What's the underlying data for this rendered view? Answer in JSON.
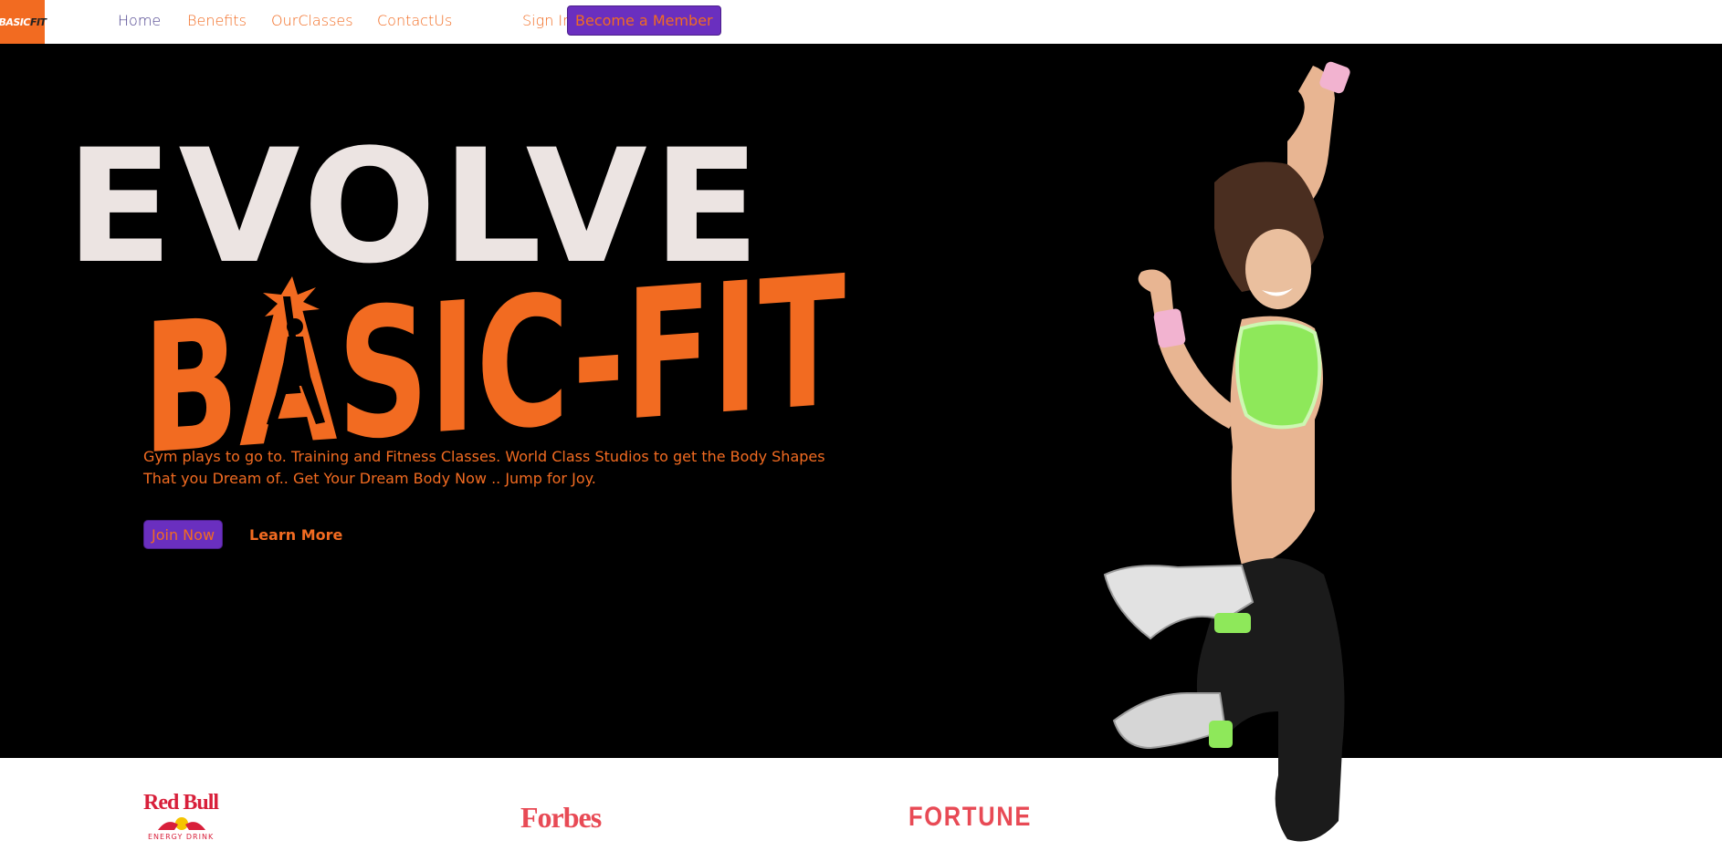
{
  "nav": {
    "logo_text_a": "BASIC",
    "logo_text_b": "FIT",
    "links": [
      "Home",
      "Benefits",
      "OurClasses",
      "ContactUs"
    ],
    "signin": "Sign In",
    "member_button": "Become a Member"
  },
  "hero": {
    "headline": "EVOLVE",
    "brand": "BASIC-FIT",
    "description": "Gym plays to go to. Training and Fitness Classes. World Class Studios to get the Body Shapes That you Dream of.. Get Your Dream Body Now .. Jump for Joy.",
    "join_button": "Join Now",
    "learn_more": "Learn More"
  },
  "sponsors": {
    "redbull_title": "Red Bull",
    "redbull_sub": "ENERGY DRINK",
    "forbes": "Forbes",
    "fortune": "FORTUNE"
  },
  "colors": {
    "accent": "#f26b21",
    "button": "#6a2fbf",
    "nav_active": "#4a3f8c",
    "sponsor": "#e84a55"
  }
}
